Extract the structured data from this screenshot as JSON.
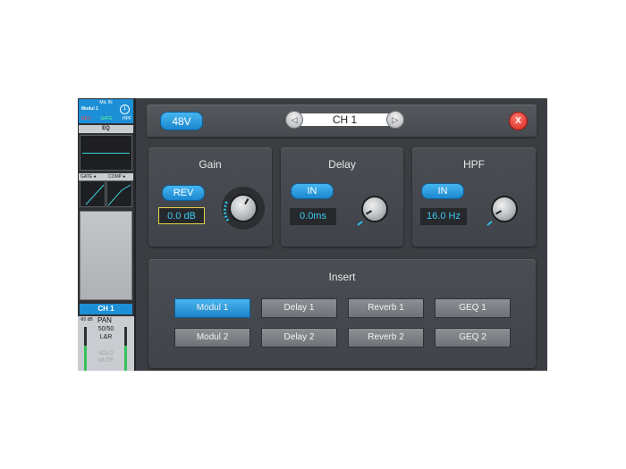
{
  "strip": {
    "source": "Mic IN",
    "module": "Modul 1",
    "number": "1",
    "flags": {
      "rev": "REV",
      "gate": "GATE",
      "hpf": "HPF"
    },
    "eq_label": "EQ",
    "gate_label": "GATE ●",
    "comp_label": "COMP ●",
    "channel": "CH 1",
    "db": "-80 dB",
    "pan_label": "PAN",
    "pan_value": "50/50",
    "route": "L&R",
    "faint1": "SOLO",
    "faint2": "MUTE"
  },
  "top_bar": {
    "phantom_label": "48V",
    "channel_name": "CH 1",
    "prev_icon": "◁",
    "next_icon": "▷",
    "close_label": "X"
  },
  "gain": {
    "title": "Gain",
    "button": "REV",
    "value": "0.0 dB"
  },
  "delay": {
    "title": "Delay",
    "button": "IN",
    "value": "0.0ms"
  },
  "hpf": {
    "title": "HPF",
    "button": "IN",
    "value": "16.0 Hz"
  },
  "insert": {
    "title": "Insert",
    "buttons": [
      "Modul 1",
      "Delay 1",
      "Reverb 1",
      "GEQ 1",
      "Modul 2",
      "Delay 2",
      "Reverb 2",
      "GEQ 2"
    ],
    "active_index": 0
  },
  "colors": {
    "accent": "#1d8fd6",
    "value_text": "#3ec8f2",
    "close": "#d2241a"
  }
}
